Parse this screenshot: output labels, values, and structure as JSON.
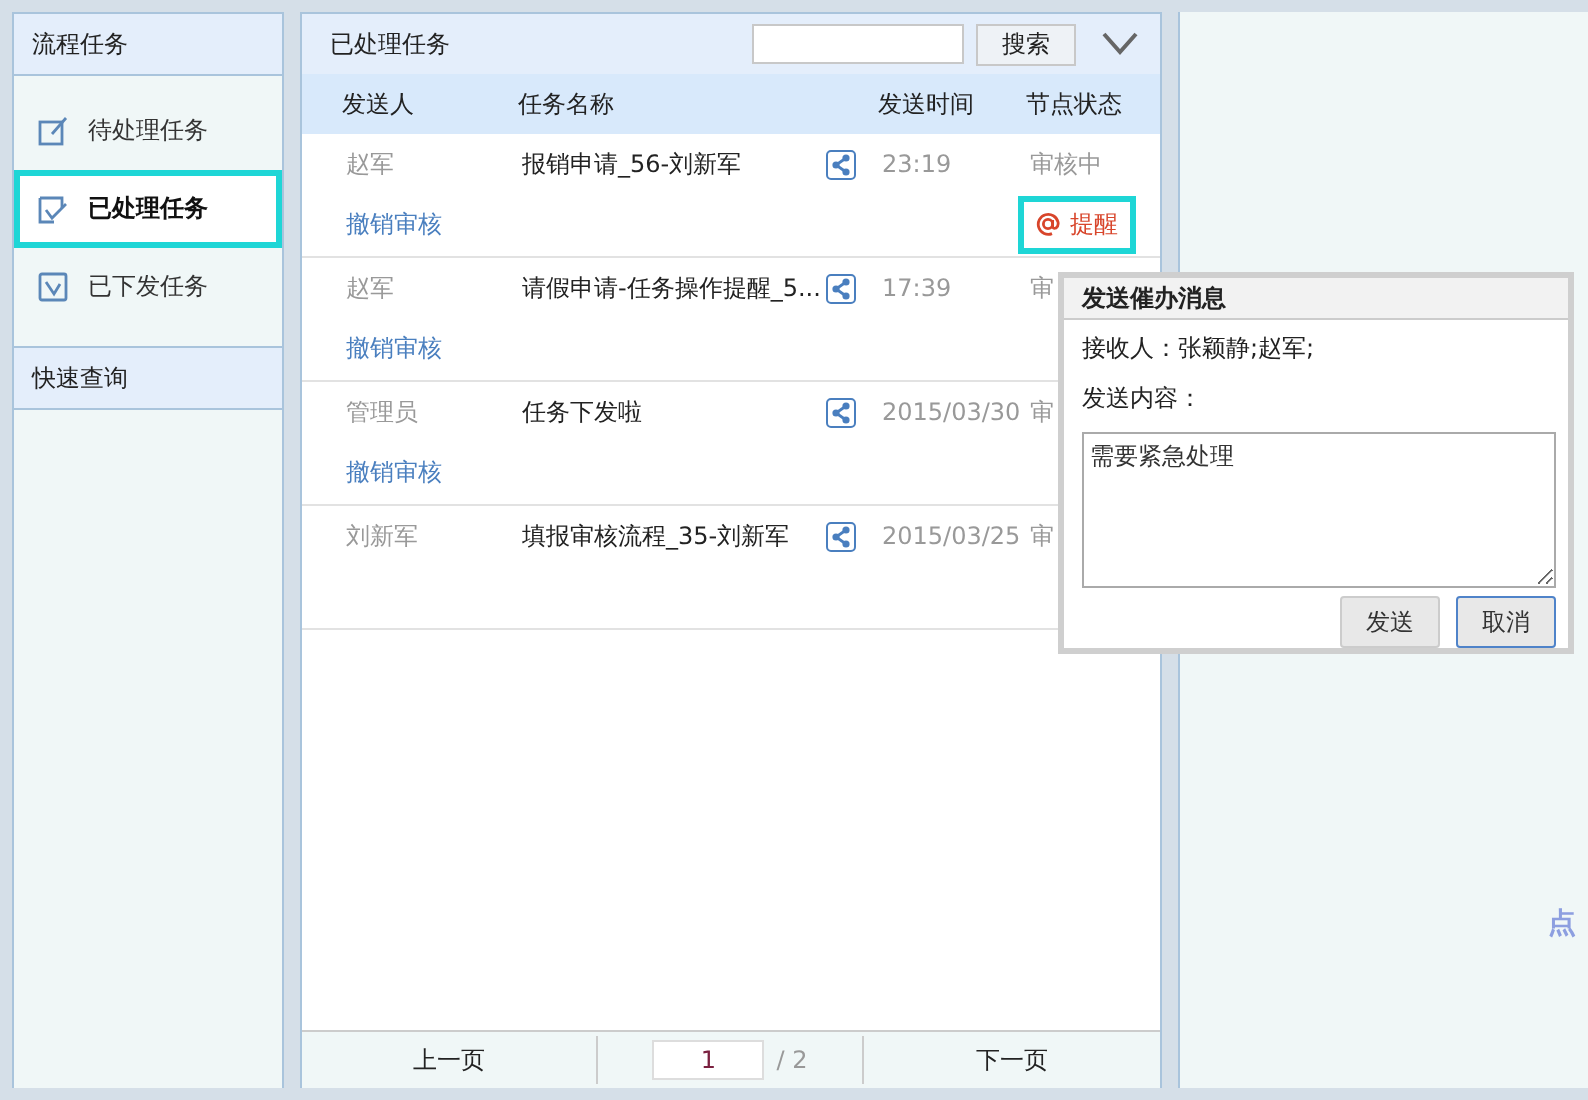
{
  "sidebar": {
    "title": "流程任务",
    "items": [
      {
        "label": "待处理任务",
        "selected": false
      },
      {
        "label": "已处理任务",
        "selected": true
      },
      {
        "label": "已下发任务",
        "selected": false
      }
    ],
    "section": "快速查询"
  },
  "main": {
    "title": "已处理任务",
    "search_button": "搜索",
    "columns": [
      "发送人",
      "任务名称",
      "发送时间",
      "节点状态"
    ],
    "rows": [
      {
        "sender": "赵军",
        "task": "报销申请_56-刘新军",
        "time": "23:19",
        "status": "审核中",
        "revoke": "撤销审核",
        "remind": {
          "label": "提醒",
          "highlighted": true
        }
      },
      {
        "sender": "赵军",
        "task": "请假申请-任务操作提醒_5...",
        "time": "17:39",
        "status": "审",
        "revoke": "撤销审核"
      },
      {
        "sender": "管理员",
        "task": "任务下发啦",
        "time": "2015/03/30",
        "status": "审",
        "revoke": "撤销审核"
      },
      {
        "sender": "刘新军",
        "task": "填报审核流程_35-刘新军",
        "time": "2015/03/25",
        "status": "审"
      }
    ],
    "pager": {
      "prev": "上一页",
      "page": "1",
      "total": "/ 2",
      "next": "下一页"
    }
  },
  "popup": {
    "title": "发送催办消息",
    "recipients": "接收人：张颖静;赵军;",
    "content_label": "发送内容：",
    "content": "需要紧急处理",
    "buttons": [
      "发送",
      "取消"
    ]
  },
  "right_panel": {
    "hint": "点"
  }
}
